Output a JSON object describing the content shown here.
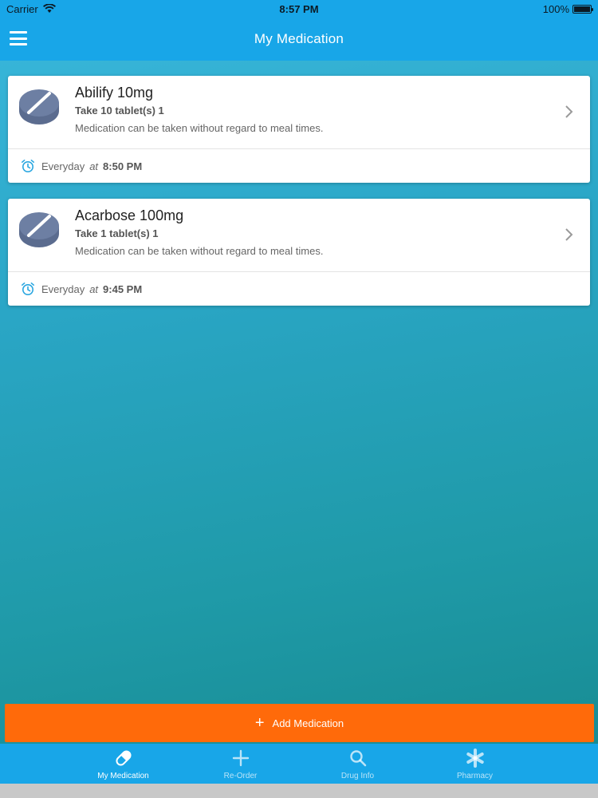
{
  "status_bar": {
    "carrier": "Carrier",
    "time": "8:57 PM",
    "battery": "100%"
  },
  "header": {
    "title": "My Medication"
  },
  "medications": [
    {
      "name": "Abilify 10mg",
      "dose": "Take 10 tablet(s) 1",
      "note": "Medication can be taken without regard to meal times.",
      "frequency": "Everyday",
      "at_label": "at",
      "time": "8:50 PM"
    },
    {
      "name": "Acarbose 100mg",
      "dose": "Take 1 tablet(s) 1",
      "note": "Medication can be taken without regard to meal times.",
      "frequency": "Everyday",
      "at_label": "at",
      "time": "9:45 PM"
    }
  ],
  "add_button": {
    "label": "Add Medication"
  },
  "tabs": [
    {
      "label": "My Medication",
      "icon": "pill-icon",
      "active": true
    },
    {
      "label": "Re-Order",
      "icon": "plus-icon",
      "active": false
    },
    {
      "label": "Drug Info",
      "icon": "search-icon",
      "active": false
    },
    {
      "label": "Pharmacy",
      "icon": "asterisk-icon",
      "active": false
    }
  ],
  "colors": {
    "accent": "#18a6e8",
    "add_button": "#ff6a0a",
    "pill_icon": "#6d7fa3"
  }
}
